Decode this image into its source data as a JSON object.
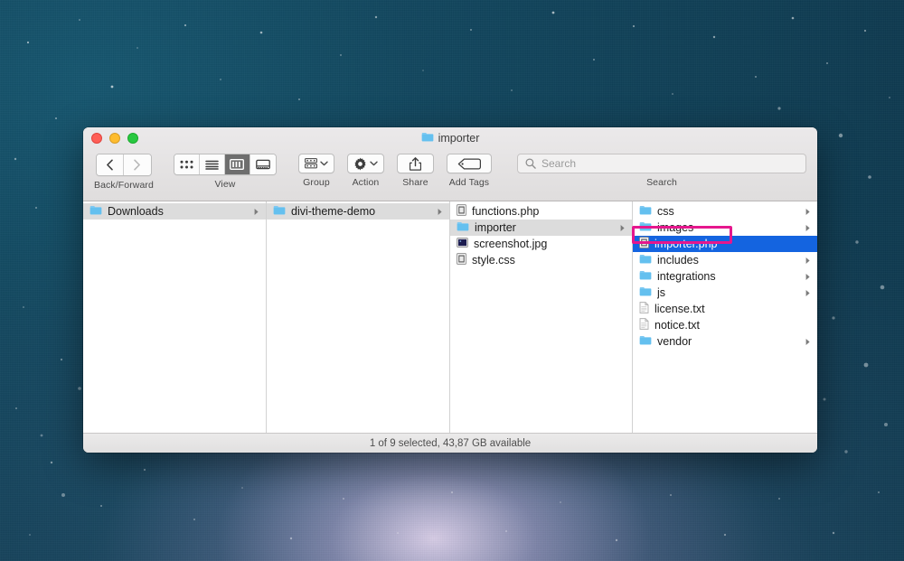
{
  "desktop": {
    "wallpaper_name": "starfield-nebula"
  },
  "window": {
    "title": "importer",
    "title_icon": "folder-icon",
    "traffic_lights": {
      "close": {
        "name": "close-button",
        "color": "#ff5f57"
      },
      "minimize": {
        "name": "minimize-button",
        "color": "#febc2e"
      },
      "maximize": {
        "name": "maximize-button",
        "color": "#28c840"
      }
    }
  },
  "toolbar": {
    "nav": {
      "label": "Back/Forward",
      "back_icon": "chevron-left-icon",
      "forward_icon": "chevron-right-icon",
      "back_enabled": true,
      "forward_enabled": false
    },
    "view": {
      "label": "View",
      "options": [
        {
          "name": "icon-view",
          "icon": "grid-icon"
        },
        {
          "name": "list-view",
          "icon": "list-icon"
        },
        {
          "name": "column-view",
          "icon": "columns-icon"
        },
        {
          "name": "gallery-view",
          "icon": "gallery-icon"
        }
      ],
      "selected_index": 2
    },
    "group": {
      "label": "Group",
      "icon": "group-icon",
      "chevron": "chevron-down-icon"
    },
    "action": {
      "label": "Action",
      "icon": "gear-icon",
      "chevron": "chevron-down-icon"
    },
    "share": {
      "label": "Share",
      "icon": "share-icon"
    },
    "add_tags": {
      "label": "Add Tags",
      "icon": "tag-icon"
    },
    "search": {
      "label": "Search",
      "placeholder": "Search",
      "value": "",
      "icon": "search-icon"
    }
  },
  "columns": [
    {
      "name": "column-downloads",
      "items": [
        {
          "label": "Downloads",
          "icon": "folder-icon",
          "has_chevron": true,
          "state": "selected-inactive"
        }
      ]
    },
    {
      "name": "column-divi-theme-demo",
      "items": [
        {
          "label": "divi-theme-demo",
          "icon": "folder-icon",
          "has_chevron": true,
          "state": "selected-inactive"
        }
      ]
    },
    {
      "name": "column-theme-contents",
      "items": [
        {
          "label": "functions.php",
          "icon": "php-file-icon",
          "has_chevron": false,
          "state": "normal"
        },
        {
          "label": "importer",
          "icon": "folder-icon",
          "has_chevron": true,
          "state": "selected-inactive"
        },
        {
          "label": "screenshot.jpg",
          "icon": "image-file-icon",
          "has_chevron": false,
          "state": "normal"
        },
        {
          "label": "style.css",
          "icon": "css-file-icon",
          "has_chevron": false,
          "state": "normal"
        }
      ]
    },
    {
      "name": "column-importer-contents",
      "items": [
        {
          "label": "css",
          "icon": "folder-icon",
          "has_chevron": true,
          "state": "normal"
        },
        {
          "label": "images",
          "icon": "folder-icon",
          "has_chevron": true,
          "state": "normal"
        },
        {
          "label": "importer.php",
          "icon": "php-file-icon",
          "has_chevron": false,
          "state": "selected-active"
        },
        {
          "label": "includes",
          "icon": "folder-icon",
          "has_chevron": true,
          "state": "normal"
        },
        {
          "label": "integrations",
          "icon": "folder-icon",
          "has_chevron": true,
          "state": "normal"
        },
        {
          "label": "js",
          "icon": "folder-icon",
          "has_chevron": true,
          "state": "normal"
        },
        {
          "label": "license.txt",
          "icon": "text-file-icon",
          "has_chevron": false,
          "state": "normal"
        },
        {
          "label": "notice.txt",
          "icon": "text-file-icon",
          "has_chevron": false,
          "state": "normal"
        },
        {
          "label": "vendor",
          "icon": "folder-icon",
          "has_chevron": true,
          "state": "normal"
        }
      ]
    }
  ],
  "annotation": {
    "name": "highlight-box-importer-php",
    "color": "#e5178d",
    "target": "importer.php"
  },
  "statusbar": {
    "text": "1 of 9 selected, 43,87 GB available"
  },
  "colors": {
    "selection_active": "#1464e0",
    "selection_inactive": "#dcdcdc",
    "folder_blue": "#6cc5f0",
    "annotation_magenta": "#e5178d"
  }
}
